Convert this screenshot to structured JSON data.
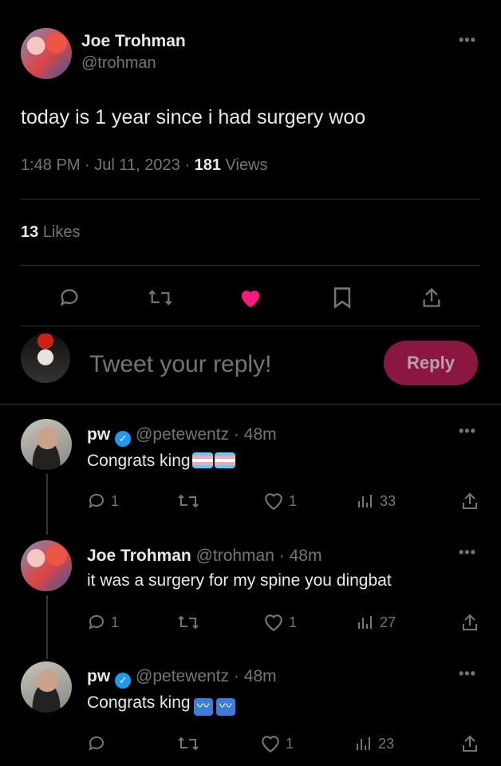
{
  "tweet": {
    "author_name": "Joe Trohman",
    "author_handle": "@trohman",
    "text": "today is 1 year since i had surgery woo",
    "time": "1:48 PM",
    "date": "Jul 11, 2023",
    "views_count": "181",
    "views_label": "Views",
    "likes_count": "13",
    "likes_label": "Likes",
    "separator": "·"
  },
  "compose": {
    "placeholder": "Tweet your reply!",
    "reply_label": "Reply"
  },
  "replies": [
    {
      "name": "pw",
      "handle": "@petewentz",
      "age": "48m",
      "text": "Congrats king",
      "replies_count": "1",
      "likes_count": "1",
      "views_count": "33"
    },
    {
      "name": "Joe Trohman",
      "handle": "@trohman",
      "age": "48m",
      "text": "it was a surgery for my spine you dingbat",
      "replies_count": "1",
      "likes_count": "1",
      "views_count": "27"
    },
    {
      "name": "pw",
      "handle": "@petewentz",
      "age": "48m",
      "text": "Congrats king",
      "replies_count": "",
      "likes_count": "1",
      "views_count": "23"
    }
  ],
  "colors": {
    "background": "#000000",
    "text": "#e7e9ea",
    "muted": "#71767b",
    "like_active": "#f91880",
    "reply_button": "#8a1742",
    "verified": "#1d9bf0"
  },
  "icons": [
    "more-icon",
    "reply-icon",
    "retweet-icon",
    "like-icon",
    "bookmark-icon",
    "share-icon",
    "views-icon",
    "verified-icon",
    "trans-flag-emoji",
    "dash-emoji"
  ]
}
